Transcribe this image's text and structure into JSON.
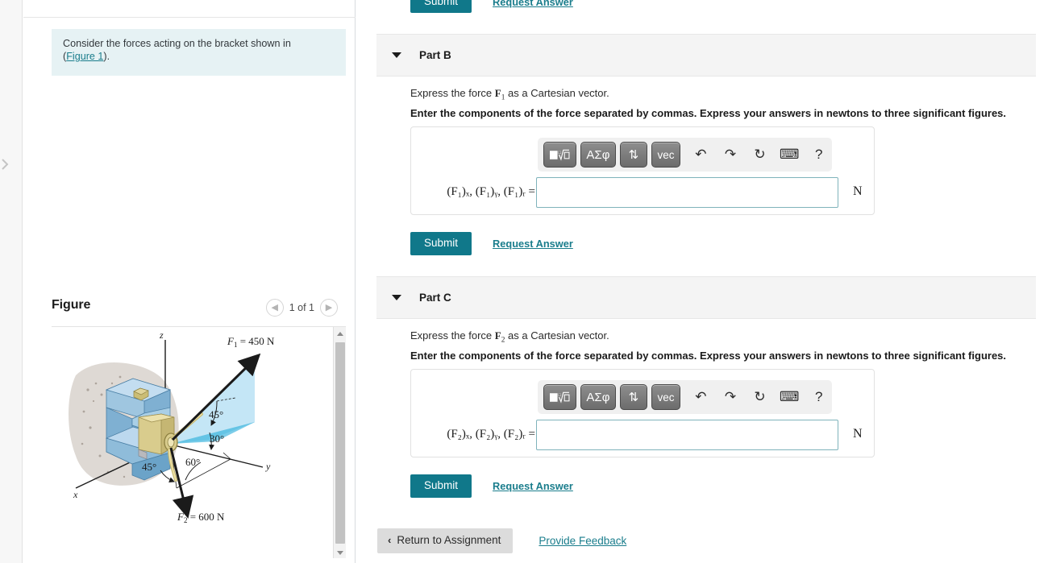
{
  "left": {
    "hint": {
      "text_before": "Consider the forces acting on the bracket shown in",
      "link": "Figure 1",
      "text_after": ")."
    },
    "figure": {
      "title": "Figure",
      "count_label": "1 of 1",
      "prev_icon": "chevron-left-icon",
      "next_icon": "chevron-right-icon"
    }
  },
  "figure_diagram": {
    "axis_z": "z",
    "axis_y": "y",
    "axis_x": "x",
    "force1_label": "F",
    "force1_sub": "1",
    "force1_value": "= 450 N",
    "force2_label": "F",
    "force2_sub": "2",
    "force2_value": "= 600 N",
    "angle_45_upper": "45°",
    "angle_30": "30°",
    "angle_60": "60°",
    "angle_45_lower": "45°"
  },
  "part_a_remnant": {
    "submit_label": "Submit",
    "request_label": "Request Answer"
  },
  "parts": [
    {
      "id": "b",
      "header_label": "Part B",
      "caret_icon": "caret-down-icon",
      "prompt_prefix": "Express the force ",
      "prompt_var": "F",
      "prompt_var_sub": "1",
      "prompt_suffix": " as a Cartesian vector.",
      "instruction": "Enter the components of the force separated by commas. Express your answers in newtons to three significant figures.",
      "answer_label_html": "(F₁)ₓ, (F₁)ᵧ, (F₁)ᵣ =",
      "answer_value": "",
      "answer_placeholder": "",
      "unit": "N",
      "submit_label": "Submit",
      "request_label": "Request Answer"
    },
    {
      "id": "c",
      "header_label": "Part C",
      "caret_icon": "caret-down-icon",
      "prompt_prefix": "Express the force ",
      "prompt_var": "F",
      "prompt_var_sub": "2",
      "prompt_suffix": " as a Cartesian vector.",
      "instruction": "Enter the components of the force separated by commas. Express your answers in newtons to three significant figures.",
      "answer_label_html": "(F₂)ₓ, (F₂)ᵧ, (F₂)ᵣ =",
      "answer_value": "",
      "answer_placeholder": "",
      "unit": "N",
      "submit_label": "Submit",
      "request_label": "Request Answer"
    }
  ],
  "mathbar": {
    "keys": [
      {
        "name": "template-radical-button",
        "glyph": "■√□"
      },
      {
        "name": "greek-letters-button",
        "glyph": "ΑΣφ"
      },
      {
        "name": "updown-arrows-button",
        "glyph": "⇅"
      },
      {
        "name": "vector-button",
        "glyph": "vec"
      }
    ],
    "icons": [
      {
        "name": "undo-icon",
        "glyph": "↶"
      },
      {
        "name": "redo-icon",
        "glyph": "↷"
      },
      {
        "name": "reset-icon",
        "glyph": "↻"
      },
      {
        "name": "keyboard-icon",
        "glyph": "⌨"
      },
      {
        "name": "help-icon",
        "glyph": "?"
      }
    ]
  },
  "footer": {
    "return_label": "Return to Assignment",
    "return_chevron": "‹",
    "feedback_label": "Provide Feedback"
  },
  "colors": {
    "teal": "#10788a",
    "link": "#1a7d8c",
    "hint_bg": "#e6f2f4",
    "part_header_bg": "#f4f4f4"
  }
}
